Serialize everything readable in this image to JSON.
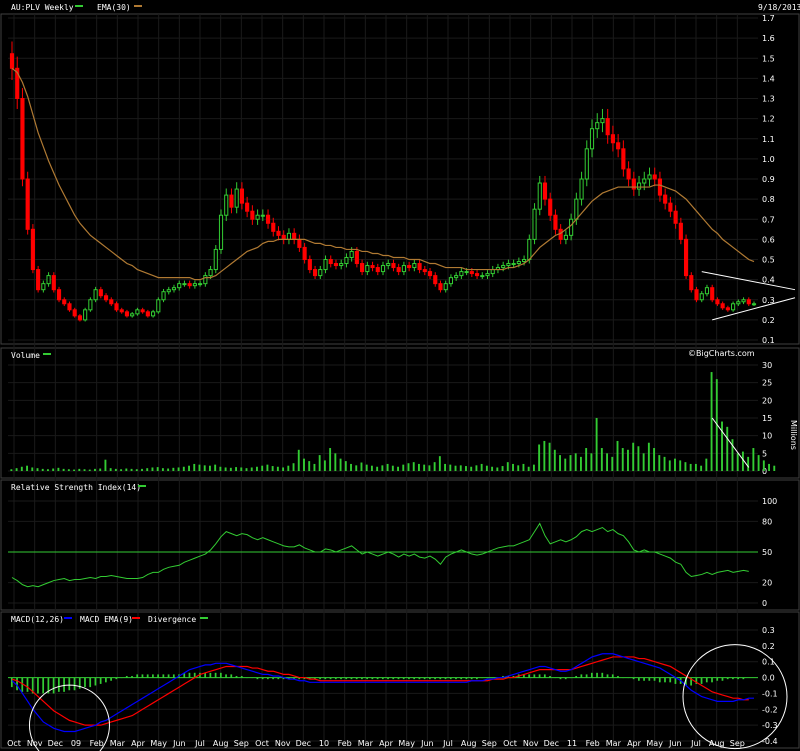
{
  "header": {
    "symbol": "AU:PLV Weekly",
    "ema_label": "EMA(30)",
    "date": "9/18/2013",
    "watermark": "©BigCharts.com"
  },
  "colors": {
    "background": "#000000",
    "up": "#33cc33",
    "down": "#ff0000",
    "ema": "#b07a33",
    "grid": "#1a1a1a",
    "panel_border": "#404040",
    "volume": "#33cc33",
    "rsi": "#33cc33",
    "macd": "#0000ff",
    "macd_signal": "#ff0000",
    "divergence": "#33cc33",
    "annotation": "#ffffff"
  },
  "x_axis": {
    "labels": [
      "Oct",
      "Nov",
      "Dec",
      "09",
      "Feb",
      "Mar",
      "Apr",
      "May",
      "Jun",
      "Jul",
      "Aug",
      "Sep",
      "Oct",
      "Nov",
      "Dec",
      "10",
      "Feb",
      "Mar",
      "Apr",
      "May",
      "Jun",
      "Jul",
      "Aug",
      "Sep",
      "Oct",
      "Nov",
      "Dec",
      "11",
      "Feb",
      "Mar",
      "Apr",
      "May",
      "Jun",
      "Jul",
      "Aug",
      "Sep"
    ]
  },
  "chart_data": [
    {
      "panel": "price",
      "type": "candlestick",
      "title": "AU:PLV Weekly",
      "legend": [
        "AU:PLV Weekly",
        "EMA(30)"
      ],
      "ylim": [
        0.1,
        1.7
      ],
      "yticks": [
        "0.1",
        "0.2",
        "0.3",
        "0.4",
        "0.5",
        "0.6",
        "0.7",
        "0.8",
        "0.9",
        "1.0",
        "1.1",
        "1.2",
        "1.3",
        "1.4",
        "1.5",
        "1.6",
        "1.7"
      ],
      "close": [
        1.45,
        1.3,
        0.9,
        0.65,
        0.45,
        0.35,
        0.38,
        0.42,
        0.35,
        0.3,
        0.28,
        0.25,
        0.22,
        0.2,
        0.25,
        0.3,
        0.35,
        0.32,
        0.3,
        0.28,
        0.25,
        0.24,
        0.22,
        0.23,
        0.25,
        0.24,
        0.22,
        0.24,
        0.3,
        0.34,
        0.35,
        0.36,
        0.38,
        0.38,
        0.37,
        0.38,
        0.38,
        0.42,
        0.45,
        0.55,
        0.72,
        0.82,
        0.76,
        0.85,
        0.78,
        0.74,
        0.7,
        0.72,
        0.72,
        0.68,
        0.64,
        0.62,
        0.6,
        0.63,
        0.6,
        0.56,
        0.5,
        0.45,
        0.42,
        0.45,
        0.5,
        0.48,
        0.47,
        0.48,
        0.51,
        0.54,
        0.48,
        0.44,
        0.47,
        0.46,
        0.44,
        0.47,
        0.48,
        0.46,
        0.44,
        0.47,
        0.46,
        0.48,
        0.45,
        0.44,
        0.42,
        0.38,
        0.35,
        0.38,
        0.41,
        0.42,
        0.44,
        0.44,
        0.43,
        0.42,
        0.42,
        0.43,
        0.45,
        0.46,
        0.47,
        0.48,
        0.48,
        0.49,
        0.5,
        0.6,
        0.75,
        0.88,
        0.8,
        0.72,
        0.65,
        0.6,
        0.62,
        0.7,
        0.8,
        0.9,
        1.05,
        1.15,
        1.18,
        1.2,
        1.12,
        1.08,
        1.05,
        0.95,
        0.9,
        0.85,
        0.88,
        0.9,
        0.92,
        0.9,
        0.82,
        0.78,
        0.74,
        0.68,
        0.6,
        0.42,
        0.35,
        0.3,
        0.33,
        0.36,
        0.3,
        0.28,
        0.26,
        0.25,
        0.28,
        0.29,
        0.3,
        0.28,
        0.28
      ],
      "ema": [
        1.45,
        1.43,
        1.38,
        1.31,
        1.22,
        1.13,
        1.06,
        0.99,
        0.93,
        0.87,
        0.82,
        0.77,
        0.72,
        0.68,
        0.65,
        0.62,
        0.6,
        0.58,
        0.56,
        0.54,
        0.52,
        0.5,
        0.48,
        0.47,
        0.45,
        0.44,
        0.43,
        0.42,
        0.41,
        0.41,
        0.41,
        0.41,
        0.41,
        0.41,
        0.41,
        0.4,
        0.4,
        0.41,
        0.41,
        0.42,
        0.44,
        0.46,
        0.48,
        0.5,
        0.52,
        0.54,
        0.55,
        0.56,
        0.58,
        0.59,
        0.59,
        0.6,
        0.6,
        0.6,
        0.6,
        0.6,
        0.6,
        0.59,
        0.58,
        0.58,
        0.57,
        0.57,
        0.56,
        0.56,
        0.55,
        0.55,
        0.55,
        0.54,
        0.54,
        0.53,
        0.53,
        0.52,
        0.52,
        0.51,
        0.51,
        0.51,
        0.5,
        0.5,
        0.5,
        0.49,
        0.48,
        0.48,
        0.47,
        0.46,
        0.46,
        0.46,
        0.46,
        0.45,
        0.45,
        0.45,
        0.45,
        0.45,
        0.45,
        0.45,
        0.45,
        0.46,
        0.46,
        0.47,
        0.48,
        0.5,
        0.53,
        0.56,
        0.58,
        0.6,
        0.62,
        0.63,
        0.65,
        0.67,
        0.7,
        0.73,
        0.76,
        0.79,
        0.81,
        0.83,
        0.84,
        0.85,
        0.86,
        0.86,
        0.86,
        0.86,
        0.86,
        0.86,
        0.86,
        0.87,
        0.87,
        0.86,
        0.85,
        0.84,
        0.82,
        0.8,
        0.77,
        0.74,
        0.71,
        0.68,
        0.65,
        0.63,
        0.6,
        0.58,
        0.56,
        0.54,
        0.52,
        0.5,
        0.49
      ]
    },
    {
      "panel": "volume",
      "type": "bar",
      "title": "Volume",
      "ylabel": "Millions",
      "ylim": [
        0,
        30
      ],
      "yticks": [
        "0",
        "5",
        "10",
        "15",
        "20",
        "25",
        "30"
      ],
      "values": [
        0.5,
        0.8,
        1.2,
        1.5,
        1,
        0.8,
        0.6,
        0.5,
        0.7,
        0.9,
        0.6,
        0.5,
        0.4,
        0.6,
        0.5,
        0.4,
        0.6,
        0.7,
        3.2,
        0.8,
        0.6,
        0.5,
        0.7,
        0.6,
        0.5,
        0.6,
        0.8,
        1.0,
        1.1,
        0.8,
        0.7,
        0.9,
        1.0,
        1.2,
        1.5,
        2.0,
        1.8,
        1.6,
        1.5,
        1.8,
        1.2,
        1.0,
        0.9,
        1.1,
        1.0,
        0.8,
        1.0,
        1.2,
        1.5,
        1.8,
        1.4,
        1.2,
        1.0,
        1.5,
        2.2,
        6.0,
        3.5,
        2.8,
        2.0,
        4.5,
        3.0,
        6.5,
        5.0,
        3.5,
        2.8,
        2.0,
        1.6,
        2.4,
        1.8,
        1.5,
        1.2,
        1.6,
        2.0,
        1.5,
        1.2,
        1.8,
        2.2,
        2.5,
        2.0,
        1.8,
        1.6,
        2.5,
        4.2,
        2.0,
        1.8,
        1.5,
        1.6,
        1.4,
        1.2,
        1.6,
        2.0,
        1.5,
        1.2,
        1.0,
        1.4,
        2.5,
        2.0,
        1.6,
        2.0,
        1.2,
        1.8,
        7.5,
        8.5,
        8.0,
        6.0,
        4.5,
        3.5,
        4.5,
        5.0,
        4.0,
        6.5,
        5.0,
        15.0,
        6.5,
        5.0,
        4.0,
        8.5,
        6.5,
        6.0,
        8.0,
        7.0,
        5.0,
        8.0,
        6.5,
        4.5,
        4.0,
        3.0,
        3.5,
        3.0,
        2.5,
        2.0,
        2.0,
        1.5,
        3.5,
        28.0,
        26.0,
        14.0,
        12.5,
        9.0,
        5.0,
        5.5,
        4.0,
        6.5,
        4.5,
        3.0,
        2.0,
        1.5
      ]
    },
    {
      "panel": "rsi",
      "type": "line",
      "title": "Relative Strength Index(14)",
      "ylim": [
        0,
        100
      ],
      "yticks": [
        "0",
        "20",
        "50",
        "80",
        "100"
      ],
      "reference_line": 50,
      "values": [
        25,
        22,
        18,
        16,
        17,
        16,
        18,
        20,
        22,
        23,
        24,
        22,
        23,
        23,
        24,
        25,
        24,
        26,
        26,
        27,
        26,
        25,
        24,
        24,
        24,
        25,
        28,
        30,
        30,
        33,
        35,
        36,
        37,
        40,
        42,
        44,
        46,
        48,
        52,
        58,
        65,
        70,
        68,
        66,
        68,
        67,
        64,
        62,
        64,
        62,
        60,
        58,
        56,
        55,
        55,
        57,
        54,
        52,
        50,
        50,
        53,
        52,
        50,
        52,
        54,
        56,
        52,
        48,
        50,
        48,
        46,
        48,
        50,
        48,
        45,
        48,
        46,
        48,
        45,
        44,
        46,
        43,
        38,
        45,
        48,
        50,
        52,
        50,
        48,
        47,
        48,
        50,
        52,
        54,
        55,
        56,
        56,
        58,
        60,
        62,
        70,
        78,
        66,
        58,
        60,
        62,
        60,
        62,
        65,
        70,
        72,
        70,
        72,
        74,
        70,
        72,
        68,
        66,
        60,
        52,
        50,
        52,
        50,
        50,
        48,
        46,
        44,
        40,
        38,
        30,
        26,
        27,
        28,
        30,
        28,
        30,
        31,
        32,
        30,
        31,
        32,
        31
      ]
    },
    {
      "panel": "macd",
      "type": "line",
      "title": "MACD(12,26)",
      "legend": [
        "MACD(12,26)",
        "MACD EMA(9)",
        "Divergence"
      ],
      "ylim": [
        -0.4,
        0.3
      ],
      "yticks": [
        "-0.4",
        "-0.3",
        "-0.2",
        "-0.1",
        "0.0",
        "0.1",
        "0.2",
        "0.3"
      ],
      "macd": [
        -0.02,
        -0.05,
        -0.1,
        -0.15,
        -0.2,
        -0.24,
        -0.28,
        -0.3,
        -0.32,
        -0.33,
        -0.34,
        -0.34,
        -0.34,
        -0.33,
        -0.32,
        -0.31,
        -0.3,
        -0.28,
        -0.27,
        -0.25,
        -0.23,
        -0.21,
        -0.19,
        -0.17,
        -0.15,
        -0.13,
        -0.11,
        -0.09,
        -0.07,
        -0.05,
        -0.03,
        -0.01,
        0.01,
        0.03,
        0.05,
        0.06,
        0.07,
        0.08,
        0.08,
        0.09,
        0.09,
        0.09,
        0.08,
        0.07,
        0.06,
        0.05,
        0.04,
        0.03,
        0.02,
        0.02,
        0.01,
        0.01,
        0.0,
        -0.01,
        -0.01,
        -0.02,
        -0.02,
        -0.03,
        -0.03,
        -0.03,
        -0.03,
        -0.03,
        -0.03,
        -0.03,
        -0.03,
        -0.03,
        -0.03,
        -0.03,
        -0.03,
        -0.03,
        -0.03,
        -0.03,
        -0.03,
        -0.03,
        -0.03,
        -0.03,
        -0.03,
        -0.03,
        -0.03,
        -0.03,
        -0.03,
        -0.03,
        -0.03,
        -0.03,
        -0.03,
        -0.03,
        -0.03,
        -0.03,
        -0.02,
        -0.02,
        -0.02,
        -0.01,
        -0.01,
        0.0,
        0.0,
        0.01,
        0.02,
        0.03,
        0.04,
        0.05,
        0.06,
        0.07,
        0.07,
        0.06,
        0.05,
        0.04,
        0.04,
        0.05,
        0.07,
        0.09,
        0.11,
        0.13,
        0.14,
        0.15,
        0.15,
        0.15,
        0.14,
        0.13,
        0.12,
        0.11,
        0.1,
        0.09,
        0.08,
        0.07,
        0.06,
        0.04,
        0.02,
        0.0,
        -0.02,
        -0.05,
        -0.08,
        -0.1,
        -0.12,
        -0.13,
        -0.14,
        -0.15,
        -0.15,
        -0.15,
        -0.15,
        -0.14,
        -0.14,
        -0.13,
        -0.13
      ],
      "signal": [
        -0.01,
        -0.02,
        -0.04,
        -0.06,
        -0.09,
        -0.12,
        -0.15,
        -0.18,
        -0.21,
        -0.23,
        -0.25,
        -0.27,
        -0.28,
        -0.29,
        -0.3,
        -0.3,
        -0.3,
        -0.3,
        -0.29,
        -0.28,
        -0.27,
        -0.26,
        -0.25,
        -0.24,
        -0.22,
        -0.2,
        -0.18,
        -0.16,
        -0.14,
        -0.12,
        -0.1,
        -0.08,
        -0.06,
        -0.04,
        -0.02,
        0.0,
        0.02,
        0.03,
        0.04,
        0.05,
        0.06,
        0.07,
        0.07,
        0.07,
        0.07,
        0.07,
        0.06,
        0.06,
        0.05,
        0.04,
        0.04,
        0.03,
        0.02,
        0.02,
        0.01,
        0.0,
        0.0,
        -0.01,
        -0.01,
        -0.02,
        -0.02,
        -0.02,
        -0.02,
        -0.02,
        -0.02,
        -0.02,
        -0.02,
        -0.02,
        -0.02,
        -0.02,
        -0.02,
        -0.02,
        -0.02,
        -0.02,
        -0.02,
        -0.02,
        -0.02,
        -0.02,
        -0.02,
        -0.02,
        -0.02,
        -0.02,
        -0.02,
        -0.02,
        -0.02,
        -0.02,
        -0.02,
        -0.02,
        -0.02,
        -0.02,
        -0.02,
        -0.02,
        -0.01,
        -0.01,
        -0.01,
        0.0,
        0.0,
        0.01,
        0.02,
        0.03,
        0.04,
        0.05,
        0.05,
        0.05,
        0.05,
        0.05,
        0.05,
        0.05,
        0.06,
        0.07,
        0.08,
        0.09,
        0.1,
        0.11,
        0.12,
        0.13,
        0.13,
        0.13,
        0.13,
        0.13,
        0.12,
        0.12,
        0.11,
        0.1,
        0.09,
        0.08,
        0.07,
        0.05,
        0.03,
        0.01,
        -0.01,
        -0.03,
        -0.05,
        -0.07,
        -0.09,
        -0.1,
        -0.11,
        -0.12,
        -0.13,
        -0.13,
        -0.14,
        -0.14
      ],
      "divergence": [
        -0.06,
        -0.08,
        -0.09,
        -0.09,
        -0.1,
        -0.1,
        -0.1,
        -0.1,
        -0.1,
        -0.09,
        -0.09,
        -0.08,
        -0.08,
        -0.07,
        -0.06,
        -0.06,
        -0.05,
        -0.04,
        -0.03,
        -0.02,
        -0.01,
        0.0,
        0.01,
        0.01,
        0.02,
        0.02,
        0.02,
        0.02,
        0.02,
        0.02,
        0.02,
        0.02,
        0.02,
        0.03,
        0.03,
        0.03,
        0.03,
        0.03,
        0.03,
        0.03,
        0.03,
        0.02,
        0.02,
        0.01,
        0.01,
        0.0,
        0.0,
        -0.01,
        -0.01,
        -0.01,
        -0.01,
        -0.01,
        -0.01,
        -0.01,
        -0.01,
        -0.01,
        -0.01,
        -0.01,
        -0.01,
        -0.01,
        -0.01,
        -0.01,
        -0.01,
        -0.01,
        -0.01,
        -0.01,
        -0.01,
        -0.01,
        -0.01,
        -0.01,
        -0.01,
        -0.01,
        -0.01,
        -0.01,
        -0.01,
        -0.01,
        -0.01,
        -0.01,
        -0.01,
        -0.01,
        -0.01,
        -0.01,
        -0.01,
        -0.01,
        -0.01,
        -0.01,
        -0.01,
        -0.01,
        -0.01,
        -0.01,
        0.0,
        0.0,
        0.0,
        0.0,
        0.01,
        0.01,
        0.01,
        0.02,
        0.02,
        0.02,
        0.02,
        0.02,
        0.02,
        0.01,
        0.0,
        -0.01,
        -0.01,
        0.0,
        0.01,
        0.02,
        0.02,
        0.03,
        0.03,
        0.03,
        0.02,
        0.02,
        0.01,
        0.0,
        0.0,
        -0.01,
        -0.02,
        -0.02,
        -0.02,
        -0.02,
        -0.03,
        -0.03,
        -0.03,
        -0.04,
        -0.04,
        -0.05,
        -0.05,
        -0.04,
        -0.04,
        -0.03,
        -0.03,
        -0.02,
        -0.02,
        -0.01,
        -0.01,
        -0.01,
        -0.01
      ]
    }
  ]
}
